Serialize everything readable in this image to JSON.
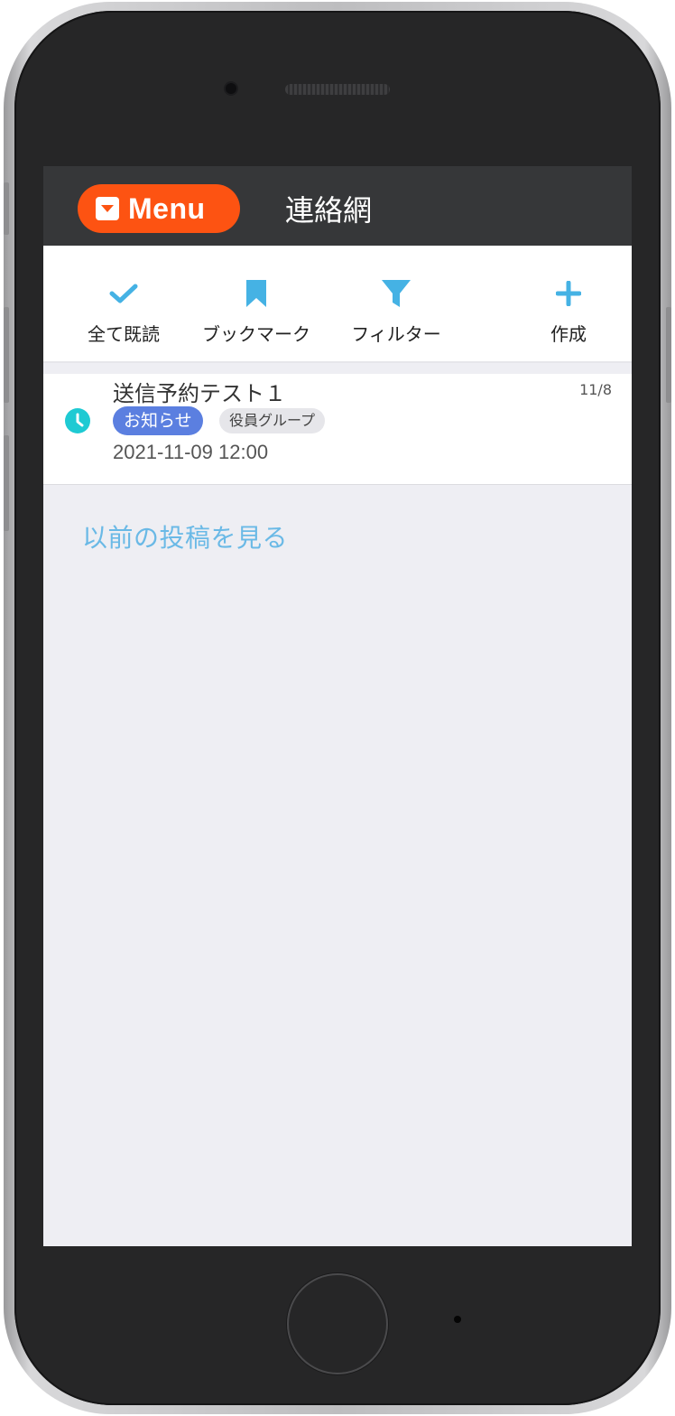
{
  "header": {
    "menu_label": "Menu",
    "title": "連絡網"
  },
  "toolbar": {
    "mark_all_read": "全て既読",
    "bookmark": "ブックマーク",
    "filter": "フィルター",
    "create": "作成"
  },
  "posts": [
    {
      "title": "送信予約テスト１",
      "date_short": "11/8",
      "category_tag": "お知らせ",
      "group_tag": "役員グループ",
      "scheduled_datetime": "2021-11-09 12:00",
      "status_icon": "clock-icon"
    }
  ],
  "older_posts_link": "以前の投稿を見る",
  "colors": {
    "menu_button": "#fd5312",
    "header_bg": "#363739",
    "accent": "#45b2e4",
    "tag_notice": "#5b7fe0",
    "clock": "#1ecad3"
  }
}
